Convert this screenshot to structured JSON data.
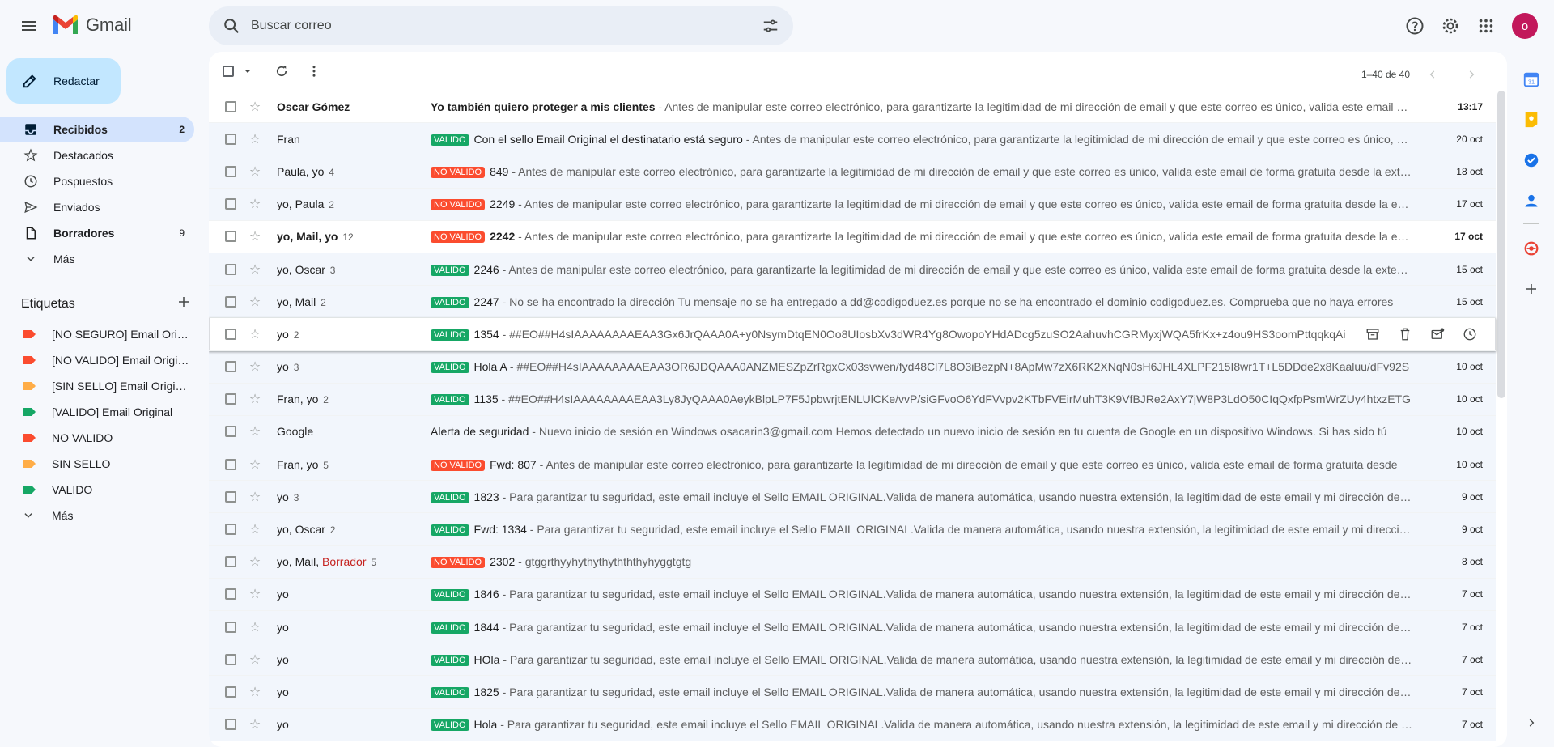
{
  "app": {
    "name": "Gmail"
  },
  "search": {
    "placeholder": "Buscar correo"
  },
  "account": {
    "initial": "o",
    "color": "#c2185b"
  },
  "compose": {
    "label": "Redactar"
  },
  "nav": [
    {
      "label": "Recibidos",
      "count": "2",
      "icon": "inbox-icon",
      "active": true
    },
    {
      "label": "Destacados",
      "count": "",
      "icon": "star-icon"
    },
    {
      "label": "Pospuestos",
      "count": "",
      "icon": "clock-icon"
    },
    {
      "label": "Enviados",
      "count": "",
      "icon": "send-icon"
    },
    {
      "label": "Borradores",
      "count": "9",
      "icon": "draft-icon",
      "bold": true
    },
    {
      "label": "Más",
      "count": "",
      "icon": "chevron-down-icon"
    }
  ],
  "labels_section": {
    "title": "Etiquetas"
  },
  "labels": [
    {
      "label": "[NO SEGURO] Email Original",
      "color": "#fb4c2f"
    },
    {
      "label": "[NO VALIDO] Email Original",
      "color": "#fb4c2f"
    },
    {
      "label": "[SIN SELLO] Email Original",
      "color": "#ffad47"
    },
    {
      "label": "[VALIDO] Email Original",
      "color": "#16a765"
    },
    {
      "label": "NO VALIDO",
      "color": "#fb4c2f"
    },
    {
      "label": "SIN SELLO",
      "color": "#ffad47"
    },
    {
      "label": "VALIDO",
      "color": "#16a765"
    }
  ],
  "labels_more": {
    "label": "Más"
  },
  "pager": {
    "range": "1–40 de 40"
  },
  "emails": [
    {
      "sender": "Oscar Gómez",
      "count": "",
      "badge": "",
      "subject": "Yo también quiero proteger a mis clientes",
      "snippet": " - Antes de manipular este correo electrónico, para garantizarte la legitimidad de mi dirección de email y que este correo es único, valida este email de forma gratuita desde",
      "date": "13:17",
      "unread": true
    },
    {
      "sender": "Fran",
      "count": "",
      "badge": "VALIDO",
      "subject": "Con el sello Email Original el destinatario está seguro",
      "snippet": " - Antes de manipular este correo electrónico, para garantizarte la legitimidad de mi dirección de email y que este correo es único, valida este email",
      "date": "20 oct"
    },
    {
      "sender": "Paula, yo",
      "count": "4",
      "badge": "NO VALIDO",
      "subject": "849",
      "snippet": " - Antes de manipular este correo electrónico, para garantizarte la legitimidad de mi dirección de email y que este correo es único, valida este email de forma gratuita desde la extensión",
      "date": "18 oct"
    },
    {
      "sender": "yo, Paula",
      "count": "2",
      "badge": "NO VALIDO",
      "subject": "2249",
      "snippet": " - Antes de manipular este correo electrónico, para garantizarte la legitimidad de mi dirección de email y que este correo es único, valida este email de forma gratuita desde la extensión",
      "date": "17 oct"
    },
    {
      "sender": "yo, Mail, yo",
      "count": "12",
      "badge": "NO VALIDO",
      "subject": "2242",
      "snippet": " - Antes de manipular este correo electrónico, para garantizarte la legitimidad de mi dirección de email y que este correo es único, valida este email de forma gratuita desde la extensión",
      "date": "17 oct",
      "unread": true
    },
    {
      "sender": "yo, Oscar",
      "count": "3",
      "badge": "VALIDO",
      "subject": "2246",
      "snippet": " - Antes de manipular este correo electrónico, para garantizarte la legitimidad de mi dirección de email y que este correo es único, valida este email de forma gratuita desde la extensión",
      "date": "15 oct"
    },
    {
      "sender": "yo, Mail",
      "count": "2",
      "badge": "VALIDO",
      "subject": "2247",
      "snippet": " - No se ha encontrado la dirección Tu mensaje no se ha entregado a dd@codigoduez.es porque no se ha encontrado el dominio codigoduez.es. Comprueba que no haya errores",
      "date": "15 oct"
    },
    {
      "sender": "yo",
      "count": "2",
      "badge": "VALIDO",
      "subject": "1354",
      "snippet": " - ##EO##H4sIAAAAAAAAEAA3Gx6JrQAAA0A+y0NsymDtqEN0Oo8UIosbXv3dWR4Yg8OwopoYHdADcg5zuSO2AahuvhCGRMyxjWQA5frKx+z4ou9HS3oomPttqqkqAi",
      "date": "",
      "hover": true
    },
    {
      "sender": "yo",
      "count": "3",
      "badge": "VALIDO",
      "subject": "Hola A",
      "snippet": " - ##EO##H4sIAAAAAAAAEAA3OR6JDQAAA0ANZMESZpZrRgxCx03svwen/fyd48Cl7L8O3iBezpN+8ApMw7zX6RK2XNqN0sH6JHL4XLPF215I8wr1T+L5DDde2x8Kaaluu/dFv92S",
      "date": "10 oct"
    },
    {
      "sender": "Fran, yo",
      "count": "2",
      "badge": "VALIDO",
      "subject": "1135",
      "snippet": " - ##EO##H4sIAAAAAAAAEAA3Ly8JyQAAA0AeykBlpLP7F5JpbwrjtENLUlCKe/vvP/siGFvoO6YdFVvpv2KTbFVEirMuhT3K9VfBJRe2AxY7jW8P3LdO50CIqQxfpPsmWrZUy4htxzETG",
      "date": "10 oct"
    },
    {
      "sender": "Google",
      "count": "",
      "badge": "",
      "subject": "Alerta de seguridad",
      "snippet": " - Nuevo inicio de sesión en Windows osacarin3@gmail.com Hemos detectado un nuevo inicio de sesión en tu cuenta de Google en un dispositivo Windows. Si has sido tú",
      "date": "10 oct"
    },
    {
      "sender": "Fran, yo",
      "count": "5",
      "badge": "NO VALIDO",
      "subject": "Fwd: 807",
      "snippet": " - Antes de manipular este correo electrónico, para garantizarte la legitimidad de mi dirección de email y que este correo es único, valida este email de forma gratuita desde",
      "date": "10 oct"
    },
    {
      "sender": "yo",
      "count": "3",
      "badge": "VALIDO",
      "subject": "1823",
      "snippet": " - Para garantizar tu seguridad, este email incluye el Sello EMAIL ORIGINAL.Valida de manera automática, usando nuestra extensión, la legitimidad de este email y mi dirección de correo",
      "date": "9 oct"
    },
    {
      "sender": "yo, Oscar",
      "count": "2",
      "badge": "VALIDO",
      "subject": "Fwd: 1334",
      "snippet": " - Para garantizar tu seguridad, este email incluye el Sello EMAIL ORIGINAL.Valida de manera automática, usando nuestra extensión, la legitimidad de este email y mi dirección de correo",
      "date": "9 oct"
    },
    {
      "sender": "yo, Mail, ",
      "draft": "Borrador",
      "count": "5",
      "badge": "NO VALIDO",
      "subject": "2302",
      "snippet": " - gtggrthyyhythythythththyhyggtgtg",
      "date": "8 oct"
    },
    {
      "sender": "yo",
      "count": "",
      "badge": "VALIDO",
      "subject": "1846",
      "snippet": " - Para garantizar tu seguridad, este email incluye el Sello EMAIL ORIGINAL.Valida de manera automática, usando nuestra extensión, la legitimidad de este email y mi dirección de correo",
      "date": "7 oct"
    },
    {
      "sender": "yo",
      "count": "",
      "badge": "VALIDO",
      "subject": "1844",
      "snippet": " - Para garantizar tu seguridad, este email incluye el Sello EMAIL ORIGINAL.Valida de manera automática, usando nuestra extensión, la legitimidad de este email y mi dirección de correo",
      "date": "7 oct"
    },
    {
      "sender": "yo",
      "count": "",
      "badge": "VALIDO",
      "subject": "HOla",
      "snippet": " - Para garantizar tu seguridad, este email incluye el Sello EMAIL ORIGINAL.Valida de manera automática, usando nuestra extensión, la legitimidad de este email y mi dirección de correo",
      "date": "7 oct"
    },
    {
      "sender": "yo",
      "count": "",
      "badge": "VALIDO",
      "subject": "1825",
      "snippet": " - Para garantizar tu seguridad, este email incluye el Sello EMAIL ORIGINAL.Valida de manera automática, usando nuestra extensión, la legitimidad de este email y mi dirección de correo",
      "date": "7 oct"
    },
    {
      "sender": "yo",
      "count": "",
      "badge": "VALIDO",
      "subject": "Hola",
      "snippet": " - Para garantizar tu seguridad, este email incluye el Sello EMAIL ORIGINAL.Valida de manera automática, usando nuestra extensión, la legitimidad de este email y mi dirección de correo",
      "date": "7 oct"
    }
  ]
}
